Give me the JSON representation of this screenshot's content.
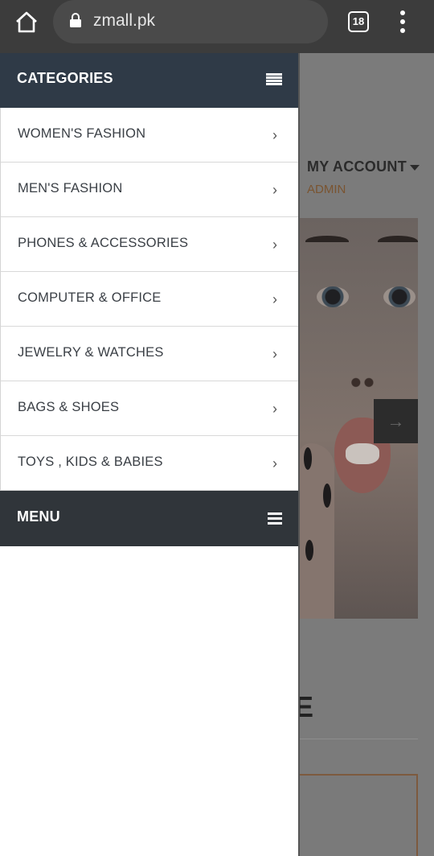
{
  "browser": {
    "url": "zmall.pk",
    "tab_count": "18",
    "icons": [
      "home-icon",
      "lock-icon",
      "tabs-icon",
      "more-vert-icon"
    ]
  },
  "background_page": {
    "account_label": "MY ACCOUNT",
    "account_sublabel": "ADMIN",
    "slider_next_glyph": "→",
    "section_letter": "E"
  },
  "sidebar": {
    "categories_title": "CATEGORIES",
    "categories": [
      {
        "label": "WOMEN'S FASHION"
      },
      {
        "label": "MEN'S FASHION"
      },
      {
        "label": "PHONES & ACCESSORIES"
      },
      {
        "label": "COMPUTER & OFFICE"
      },
      {
        "label": "JEWELRY & WATCHES"
      },
      {
        "label": "BAGS & SHOES"
      },
      {
        "label": "TOYS , KIDS & BABIES"
      }
    ],
    "menu_title": "MENU"
  },
  "colors": {
    "browser_bar": "#3c3c3c",
    "categories_header": "#2f3a47",
    "menu_header": "#30353a",
    "accent_admin": "#c77b3a"
  }
}
